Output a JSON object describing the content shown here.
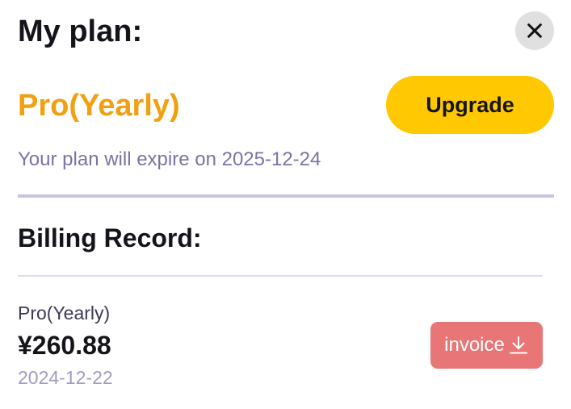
{
  "header": {
    "title": "My plan:",
    "close_icon": "close-icon"
  },
  "plan": {
    "name": "Pro(Yearly)",
    "upgrade_label": "Upgrade",
    "expiry_text": "Your plan will expire on 2025-12-24"
  },
  "billing": {
    "title": "Billing Record:",
    "records": [
      {
        "plan": "Pro(Yearly)",
        "amount": "¥260.88",
        "date": "2024-12-22",
        "invoice_label": "invoice",
        "invoice_icon": "download-icon"
      }
    ]
  },
  "colors": {
    "plan_accent": "#f0a010",
    "upgrade_button": "#ffc800",
    "invoice_button": "#e87676",
    "expiry_text": "#7c73a4",
    "divider": "#c9c4e2"
  }
}
